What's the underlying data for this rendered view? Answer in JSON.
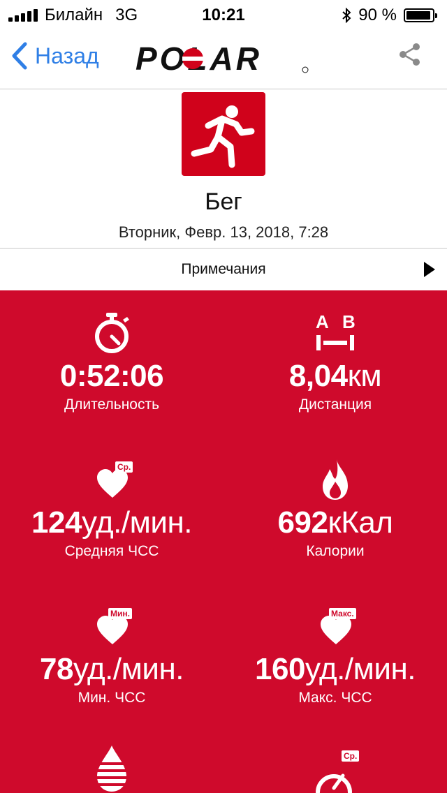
{
  "status_bar": {
    "carrier": "Билайн",
    "network": "3G",
    "time": "10:21",
    "battery_percent": "90 %",
    "battery_level": 0.9
  },
  "nav": {
    "back_label": "Назад",
    "logo_text": "POLAR",
    "share_icon": "share-icon"
  },
  "activity": {
    "sport_icon": "running-icon",
    "sport_name": "Бег",
    "date": "Вторник, Февр. 13, 2018, 7:28"
  },
  "notes": {
    "label": "Примечания"
  },
  "stats": [
    {
      "icon": "stopwatch-icon",
      "value": "0:52:06",
      "unit": "",
      "label": "Длительность"
    },
    {
      "icon": "distance-icon",
      "value": "8,04",
      "unit": "км",
      "label": "Дистанция",
      "icon_text_a": "A",
      "icon_text_b": "B"
    },
    {
      "icon": "heart-avg-icon",
      "value": "124",
      "unit": "уд./мин.",
      "label": "Средняя ЧСС",
      "badge": "Ср."
    },
    {
      "icon": "flame-icon",
      "value": "692",
      "unit": "кКал",
      "label": "Калории"
    },
    {
      "icon": "heart-min-icon",
      "value": "78",
      "unit": "уд./мин.",
      "label": "Мин. ЧСС",
      "badge": "Мин."
    },
    {
      "icon": "heart-max-icon",
      "value": "160",
      "unit": "уд./мин.",
      "label": "Макс. ЧСС",
      "badge": "Макс."
    },
    {
      "icon": "fat-burn-icon",
      "value": "",
      "unit": "",
      "label": ""
    },
    {
      "icon": "speedometer-avg-icon",
      "value": "",
      "unit": "",
      "label": "",
      "badge": "Ср."
    }
  ],
  "colors": {
    "accent_red": "#cf0a2c",
    "link_blue": "#2f7fe6"
  }
}
